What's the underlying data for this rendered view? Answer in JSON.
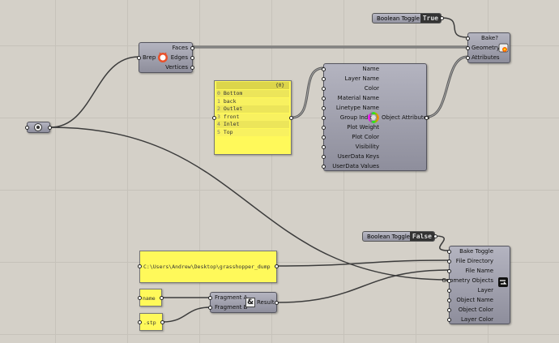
{
  "toggle_top": {
    "label": "Boolean Toggle",
    "value": "True"
  },
  "toggle_bottom": {
    "label": "Boolean Toggle",
    "value": "False"
  },
  "bake": {
    "inputs": [
      "Bake?",
      "Geometry",
      "Attributes"
    ]
  },
  "deconstruct_brep": {
    "input": "Brep",
    "outputs": [
      "Faces",
      "Edges",
      "Vertices"
    ]
  },
  "list_panel": {
    "header": "{0}",
    "items": [
      {
        "i": "0",
        "v": "Bottom"
      },
      {
        "i": "1",
        "v": "back"
      },
      {
        "i": "2",
        "v": "Outlet"
      },
      {
        "i": "3",
        "v": "front"
      },
      {
        "i": "4",
        "v": "Inlet"
      },
      {
        "i": "5",
        "v": "Top"
      }
    ]
  },
  "object_attributes": {
    "inputs": [
      "Name",
      "Layer Name",
      "Color",
      "Material Name",
      "Linetype Name",
      "Group Indices",
      "Plot Weight",
      "Plot Color",
      "Visibility",
      "UserData Keys",
      "UserData Values"
    ],
    "output": "Object Attributes"
  },
  "path_panel": {
    "text": "C:\\Users\\Andrew\\Desktop\\grasshopper_dump"
  },
  "name_panel": {
    "text": "name"
  },
  "ext_panel": {
    "text": ".stp"
  },
  "concatenate": {
    "inputs": [
      "Fragment A",
      "Fragment B"
    ],
    "output": "Result"
  },
  "exporter": {
    "inputs": [
      "Bake Toggle",
      "File Directory",
      "File Name",
      "Geometry Objects",
      "Layer",
      "Object Name",
      "Object Color",
      "Layer Color"
    ]
  }
}
